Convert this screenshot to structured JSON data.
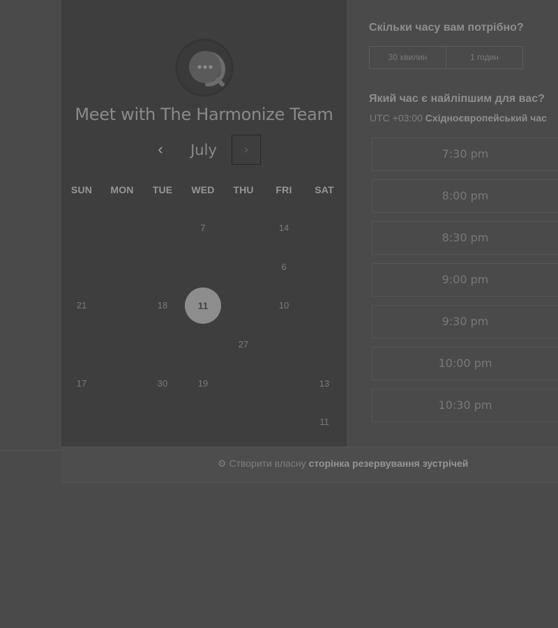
{
  "calendar": {
    "title": "Meet with The Harmonize Team",
    "month": "July",
    "prev_glyph": "‹",
    "next_glyph": "›",
    "weekdays": [
      "SUN",
      "MON",
      "TUE",
      "WED",
      "THU",
      "FRI",
      "SAT"
    ],
    "days": [
      {
        "label": "7",
        "col": 3,
        "row": 0
      },
      {
        "label": "14",
        "col": 5,
        "row": 0
      },
      {
        "label": "6",
        "col": 5,
        "row": 1
      },
      {
        "label": "21",
        "col": 0,
        "row": 2
      },
      {
        "label": "18",
        "col": 2,
        "row": 2
      },
      {
        "label": "11",
        "col": 3,
        "row": 2,
        "selected": true
      },
      {
        "label": "10",
        "col": 5,
        "row": 2
      },
      {
        "label": "27",
        "col": 4,
        "row": 3
      },
      {
        "label": "17",
        "col": 0,
        "row": 4
      },
      {
        "label": "30",
        "col": 2,
        "row": 4
      },
      {
        "label": "19",
        "col": 3,
        "row": 4
      },
      {
        "label": "13",
        "col": 6,
        "row": 4
      },
      {
        "label": "11",
        "col": 6,
        "row": 5
      }
    ]
  },
  "duration": {
    "question": "Скільки часу вам потрібно?",
    "options": [
      "30 хвилин",
      "1 годин"
    ]
  },
  "time": {
    "question": "Який час є найліпшим для вас?",
    "tz_offset": "UTC +03:00",
    "tz_name": "Східноєвропейський час",
    "slots": [
      "7:30 pm",
      "8:00 pm",
      "8:30 pm",
      "9:00 pm",
      "9:30 pm",
      "10:00 pm",
      "10:30 pm"
    ]
  },
  "footer": {
    "icon": "hubspot-sprocket-icon",
    "prefix": "Створити власну",
    "bold": "сторінка резервування зустрічей"
  },
  "colors": {
    "background": "#4a4a4a",
    "panel": "#3e3e3e",
    "selected_day": "#8d8d8d"
  }
}
